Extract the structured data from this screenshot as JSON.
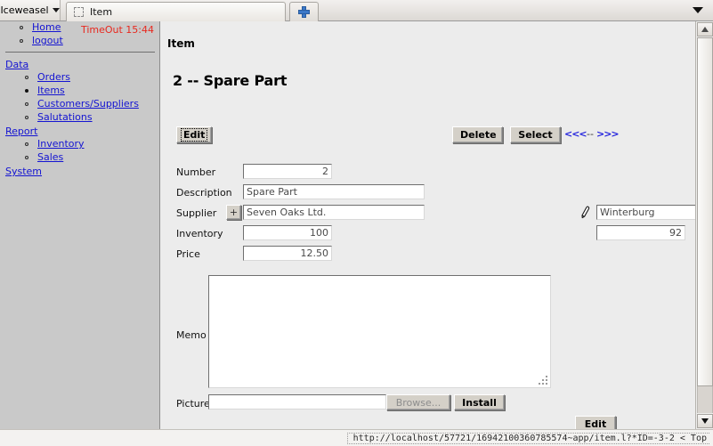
{
  "browser": {
    "app_menu_label": "Iceweasel",
    "tab_title": "Item",
    "new_tab_label": "+",
    "status_url": "http://localhost/57721/16942100360785574~app/item.l?*ID=-3-2 < Top"
  },
  "sidebar": {
    "timeout": "TimeOut 15:44",
    "top_links": [
      {
        "label": "Home"
      },
      {
        "label": "logout"
      }
    ],
    "groups": [
      {
        "label": "Data",
        "items": [
          {
            "label": "Orders",
            "current": false
          },
          {
            "label": "Items",
            "current": true
          },
          {
            "label": "Customers/Suppliers",
            "current": false
          },
          {
            "label": "Salutations",
            "current": false
          }
        ]
      },
      {
        "label": "Report",
        "items": [
          {
            "label": "Inventory",
            "current": false
          },
          {
            "label": "Sales",
            "current": false
          }
        ]
      },
      {
        "label": "System",
        "items": []
      }
    ]
  },
  "content": {
    "page_kind": "Item",
    "record_title": "2 -- Spare Part",
    "toolbar": {
      "edit_label": "Edit",
      "delete_label": "Delete",
      "select_label": "Select",
      "prev_label": "<<<",
      "separator": "--",
      "next_label": ">>>"
    },
    "fields": {
      "number_label": "Number",
      "number_value": "2",
      "description_label": "Description",
      "description_value": "Spare Part",
      "supplier_label": "Supplier",
      "supplier_add_label": "+",
      "supplier_value": "Seven Oaks Ltd.",
      "supplier_city_value": "Winterburg",
      "inventory_label": "Inventory",
      "inventory_value": "100",
      "inventory_secondary_value": "92",
      "price_label": "Price",
      "price_value": "12.50",
      "memo_label": "Memo",
      "memo_value": "",
      "picture_label": "Picture",
      "picture_value": "",
      "browse_label": "Browse...",
      "install_label": "Install"
    },
    "footer": {
      "edit_label": "Edit"
    }
  },
  "colors": {
    "link": "#1414d2",
    "timeout": "#e8281e",
    "sidebar_bg": "#c9c9c9",
    "content_bg": "#ececec",
    "button_face": "#d4d0c8"
  }
}
